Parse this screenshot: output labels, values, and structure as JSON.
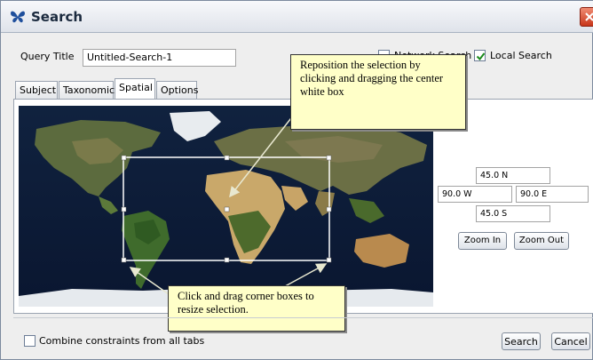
{
  "window": {
    "title": "Search",
    "colors": {
      "titlebar": "#dfe3ea",
      "close": "#c8361b",
      "callout_bg": "#ffffc8",
      "selection": "#ffffff",
      "ocean": "#0b1a33"
    }
  },
  "query": {
    "title_label": "Query Title",
    "title_value": "Untitled-Search-1",
    "network_search_label": "Network Search",
    "network_search_checked": false,
    "local_search_label": "Local Search",
    "local_search_checked": true
  },
  "tabs": [
    {
      "label": "Subject",
      "active": false
    },
    {
      "label": "Taxonomic",
      "active": false
    },
    {
      "label": "Spatial",
      "active": true
    },
    {
      "label": "Options",
      "active": false
    }
  ],
  "spatial": {
    "north": "45.0 N",
    "west": "90.0 W",
    "east": "90.0 E",
    "south": "45.0 S",
    "zoom_in_label": "Zoom In",
    "zoom_out_label": "Zoom Out"
  },
  "callouts": {
    "top": "Reposition the selection by clicking and dragging the center white box",
    "bottom": "Click and drag corner boxes to resize selection."
  },
  "footer": {
    "combine_label": "Combine constraints from all tabs",
    "combine_checked": false,
    "search_label": "Search",
    "cancel_label": "Cancel"
  }
}
